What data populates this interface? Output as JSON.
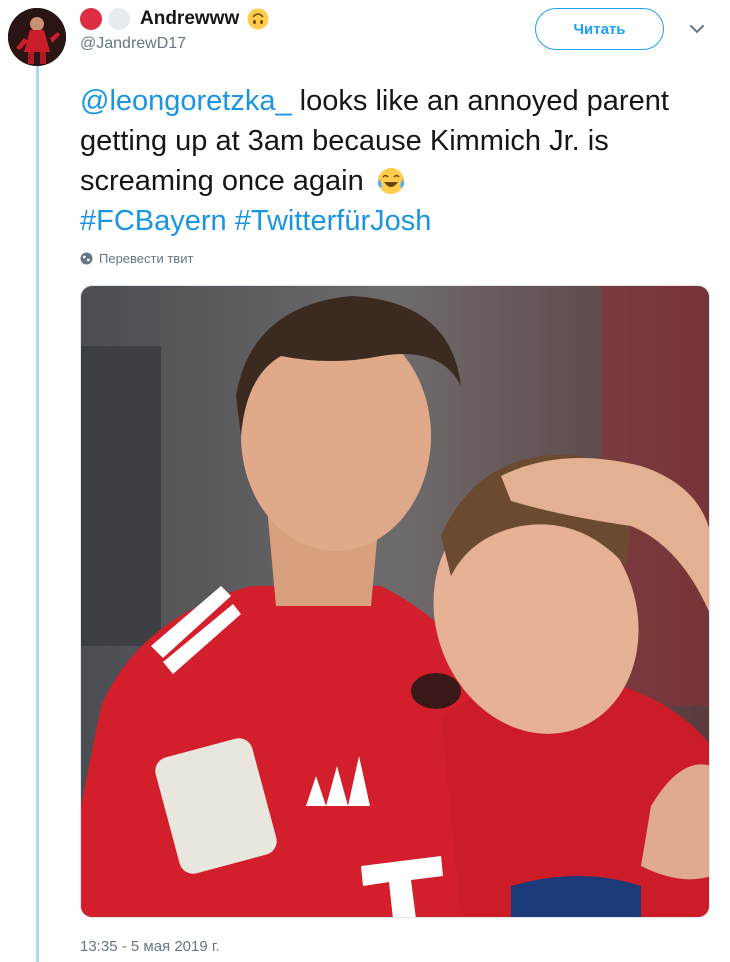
{
  "user": {
    "display_name": "Andrewww",
    "handle": "@JandrewD17",
    "avatar_icon": "avatar-photo",
    "badges": [
      "red-circle-emoji",
      "white-circle-emoji"
    ],
    "name_emoji": "upside-down-face-emoji"
  },
  "header": {
    "follow_label": "Читать",
    "menu_icon": "chevron-down-icon"
  },
  "tweet": {
    "mention": "@leongoretzka_",
    "body": " looks like an annoyed parent getting up at 3am because Kimmich Jr. is screaming once again ",
    "emoji": "face-with-tears-of-joy-emoji",
    "hashtag_1": "#FCBayern",
    "hashtag_2": "#TwitterfürJosh",
    "translate_label": "Перевести твит",
    "timestamp": "13:35 - 5 мая 2019 г."
  },
  "media": {
    "description_icon": "photo-two-footballers-embracing"
  },
  "colors": {
    "link": "#1b95e0",
    "accent": "#1da1f2",
    "thread_line": "#a9dcf3",
    "secondary_text": "#657786"
  }
}
